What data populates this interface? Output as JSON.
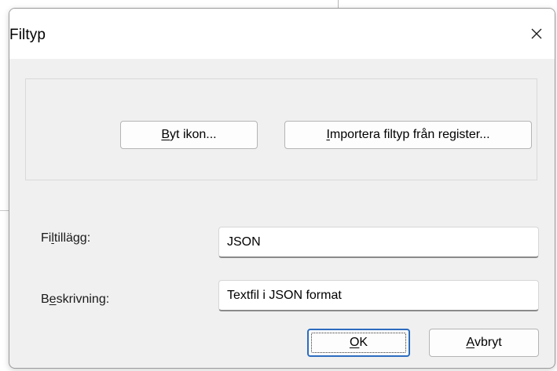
{
  "dialog": {
    "title": "Filtyp"
  },
  "icons": {
    "close": "close-icon"
  },
  "buttons": {
    "change_icon": {
      "mnemonic": "B",
      "rest": "yt ikon..."
    },
    "import": {
      "mnemonic": "I",
      "rest": "mportera filtyp från register..."
    },
    "ok": {
      "mnemonic": "O",
      "rest": "K"
    },
    "cancel": {
      "mnemonic": "A",
      "rest": "vbryt"
    }
  },
  "fields": {
    "extension": {
      "label_pre": "Fi",
      "label_mnemonic": "l",
      "label_post": "tillägg:",
      "value": "JSON"
    },
    "description": {
      "label_pre": "B",
      "label_mnemonic": "e",
      "label_post": "skrivning:",
      "value": "Textfil i JSON format"
    }
  },
  "colors": {
    "dialog_background": "#f0f0f0",
    "titlebar_background": "#ffffff",
    "default_button_border": "#2b6cbf"
  }
}
